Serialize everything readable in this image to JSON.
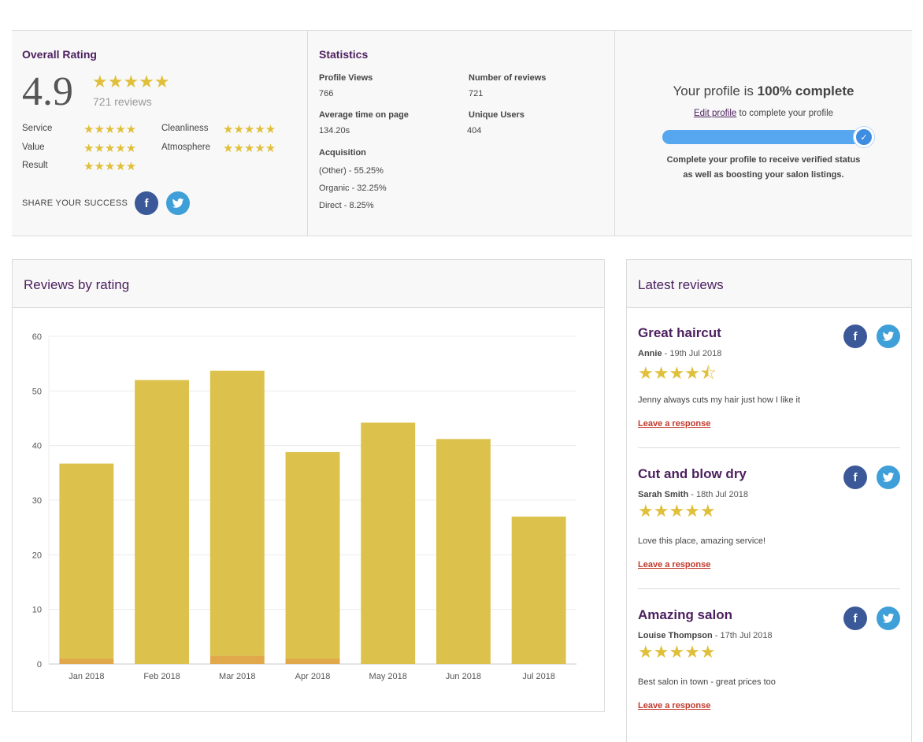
{
  "overall": {
    "title": "Overall Rating",
    "rating": "4.9",
    "stars": "★★★★★",
    "reviews": "721 reviews",
    "categories": [
      {
        "label": "Service",
        "stars": "★★★★★"
      },
      {
        "label": "Cleanliness",
        "stars": "★★★★★"
      },
      {
        "label": "Value",
        "stars": "★★★★★"
      },
      {
        "label": "Atmosphere",
        "stars": "★★★★★"
      },
      {
        "label": "Result",
        "stars": "★★★★★"
      }
    ],
    "share_label": "SHARE YOUR SUCCESS",
    "fb_glyph": "f"
  },
  "statistics": {
    "title": "Statistics",
    "profile_views_label": "Profile Views",
    "profile_views": "766",
    "num_reviews_label": "Number of reviews",
    "num_reviews": "721",
    "avg_time_label": "Average time on page",
    "avg_time": "134.20s",
    "unique_users_label": "Unique Users",
    "unique_users": "404",
    "acquisition_label": "Acquisition",
    "acquisition": [
      "(Other) - 55.25%",
      "Organic - 32.25%",
      "Direct - 8.25%"
    ]
  },
  "profile": {
    "prefix": "Your profile is ",
    "percent": "100% complete",
    "edit_link": "Edit profile",
    "edit_suffix": " to complete your profile",
    "progress": 1.0,
    "check": "✓",
    "note_line1": "Complete your profile to receive verified status",
    "note_line2": "as well as boosting your salon listings."
  },
  "reviews_chart": {
    "title": "Reviews by rating"
  },
  "chart_data": {
    "type": "bar",
    "stacked": true,
    "categories": [
      "Jan 2018",
      "Feb 2018",
      "Mar 2018",
      "Apr 2018",
      "May 2018",
      "Jun 2018",
      "Jul 2018"
    ],
    "series": [
      {
        "values": [
          1,
          0,
          1.5,
          1,
          0,
          0,
          0
        ],
        "color": "#e0a84a"
      },
      {
        "values": [
          35.7,
          52,
          52.2,
          37.8,
          44.2,
          41.2,
          27
        ],
        "color": "#dcc24d"
      }
    ],
    "ylim": [
      0,
      60
    ],
    "yticks": [
      "0",
      "10",
      "20",
      "30",
      "40",
      "50",
      "60"
    ],
    "grid": true
  },
  "latest": {
    "title": "Latest reviews",
    "link_label": "Leave a response",
    "items": [
      {
        "title": "Great haircut",
        "author": "Annie",
        "date": " - 19th Jul 2018",
        "stars": "★★★★",
        "half": "⯪",
        "rating": 4.5,
        "body": "Jenny always cuts my hair just how I like it"
      },
      {
        "title": "Cut and blow dry",
        "author": "Sarah Smith",
        "date": " - 18th Jul 2018",
        "stars": "★★★★★",
        "half": "",
        "rating": 5,
        "body": "Love this place, amazing service!"
      },
      {
        "title": "Amazing salon",
        "author": "Louise Thompson",
        "date": " - 17th Jul 2018",
        "stars": "★★★★★",
        "half": "",
        "rating": 5,
        "body": "Best salon in town - great prices too"
      }
    ]
  }
}
